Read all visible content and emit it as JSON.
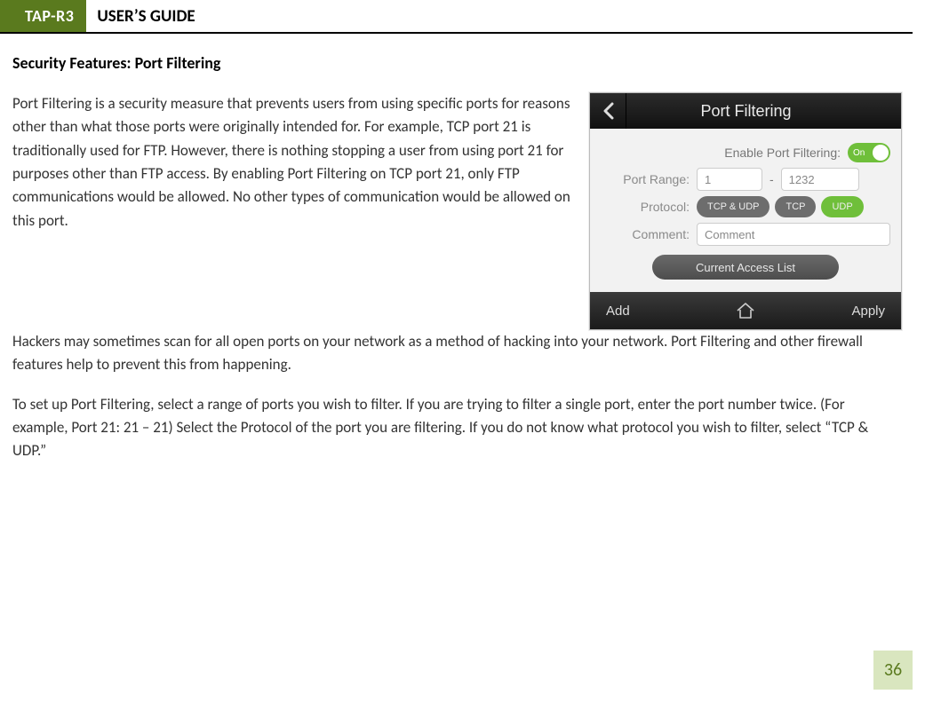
{
  "header": {
    "tag": "TAP-R3",
    "title": "USER’S GUIDE"
  },
  "section_title": "Security Features: Port Filtering",
  "para1": "Port Filtering is a security measure that prevents users from using specific ports for reasons other than what those ports were originally intended for.  For example, TCP port 21 is traditionally used for FTP.  However, there is nothing stopping a user from using port 21 for purposes other than FTP access.  By enabling Port Filtering on TCP port 21, only FTP communications would be allowed.  No other types of communication would be allowed on this port.",
  "para2": "Hackers may sometimes scan for all open ports on your network as a method of hacking into your network.  Port Filtering and other firewall features help to prevent this from happening.",
  "para3": "To set up Port Filtering, select a range of ports you wish to filter.  If you are trying to filter a single port, enter the port number twice.  (For example, Port 21:  21 – 21) Select the Protocol of the port you are filtering.  If you do not know what protocol you wish to filter, select “TCP & UDP.”",
  "shot": {
    "title": "Port Filtering",
    "enable_label": "Enable Port Filtering:",
    "toggle_text": "On",
    "port_range_label": "Port Range:",
    "port_from": "1",
    "port_sep": "-",
    "port_to": "1232",
    "protocol_label": "Protocol:",
    "protocol_options": [
      "TCP & UDP",
      "TCP",
      "UDP"
    ],
    "protocol_active_index": 2,
    "comment_label": "Comment:",
    "comment_placeholder": "Comment",
    "access_list_btn": "Current Access List",
    "footer_left": "Add",
    "footer_right": "Apply"
  },
  "page_number": "36"
}
